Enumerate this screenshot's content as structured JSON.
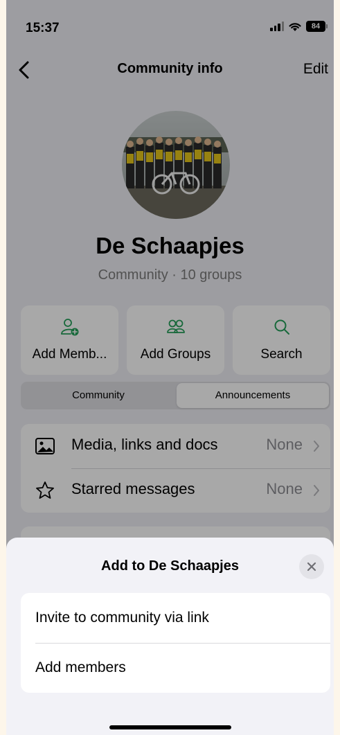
{
  "status_bar": {
    "time": "15:37",
    "battery": "84"
  },
  "navbar": {
    "title": "Community info",
    "edit_label": "Edit"
  },
  "profile": {
    "name": "De Schaapjes",
    "subtitle": "Community · 10 groups"
  },
  "actions": [
    {
      "label": "Add Memb...",
      "icon": "add-person-icon"
    },
    {
      "label": "Add Groups",
      "icon": "groups-icon"
    },
    {
      "label": "Search",
      "icon": "search-icon"
    }
  ],
  "segments": {
    "community": "Community",
    "announcements": "Announcements",
    "selected": "Announcements"
  },
  "rows": [
    {
      "label": "Media, links and docs",
      "value": "None",
      "icon": "photo-icon"
    },
    {
      "label": "Starred messages",
      "value": "None",
      "icon": "star-icon"
    }
  ],
  "sheet": {
    "title": "Add to De Schaapjes",
    "options": [
      "Invite to community via link",
      "Add members"
    ]
  },
  "colors": {
    "accent": "#25a05a",
    "background": "#efeff4"
  }
}
